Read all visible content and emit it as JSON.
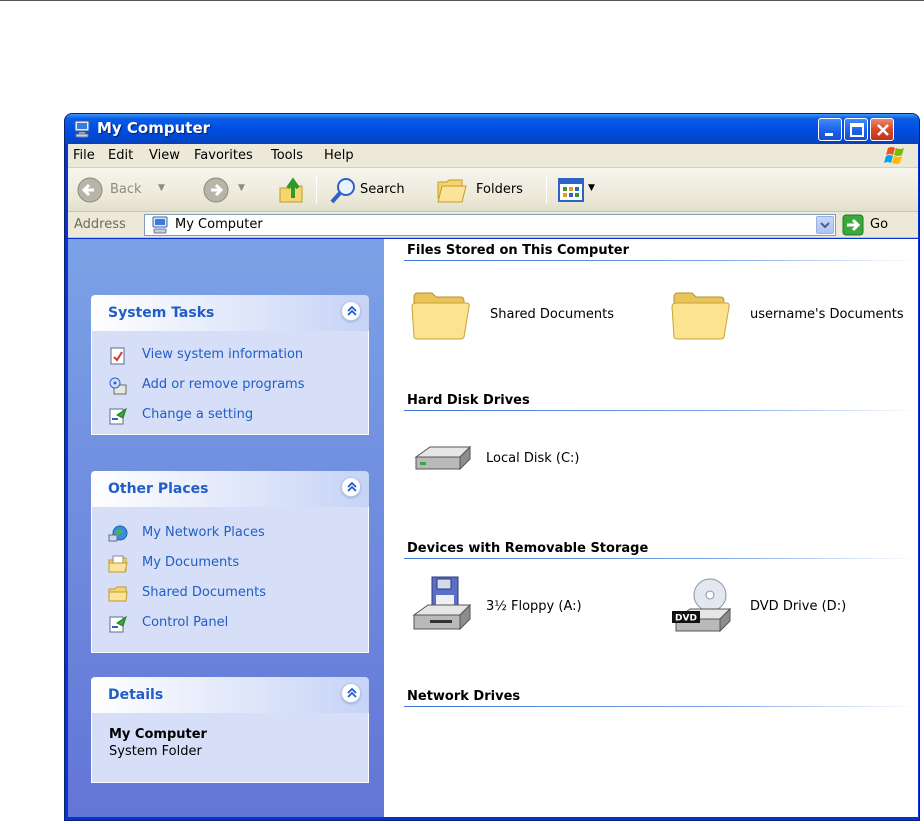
{
  "window": {
    "title": "My Computer"
  },
  "menu": {
    "file": "File",
    "edit": "Edit",
    "view": "View",
    "favorites": "Favorites",
    "tools": "Tools",
    "help": "Help"
  },
  "toolbar": {
    "back": "Back",
    "search": "Search",
    "folders": "Folders"
  },
  "address": {
    "label": "Address",
    "value": "My Computer",
    "go": "Go"
  },
  "panels": {
    "system_tasks": {
      "title": "System Tasks",
      "items": [
        {
          "label": "View system information",
          "icon": "system-info-icon"
        },
        {
          "label": "Add or remove programs",
          "icon": "add-remove-programs-icon"
        },
        {
          "label": "Change a setting",
          "icon": "control-panel-icon"
        }
      ]
    },
    "other_places": {
      "title": "Other Places",
      "items": [
        {
          "label": "My Network Places",
          "icon": "network-places-icon"
        },
        {
          "label": "My Documents",
          "icon": "my-documents-icon"
        },
        {
          "label": "Shared Documents",
          "icon": "folder-icon"
        },
        {
          "label": "Control Panel",
          "icon": "control-panel-icon"
        }
      ]
    },
    "details": {
      "title": "Details",
      "name": "My Computer",
      "type": "System Folder"
    }
  },
  "groups": {
    "files": {
      "title": "Files Stored on This Computer",
      "items": [
        {
          "label": "Shared Documents",
          "icon": "folder-icon"
        },
        {
          "label": "username's Documents",
          "icon": "folder-icon"
        }
      ]
    },
    "hdd": {
      "title": "Hard Disk Drives",
      "items": [
        {
          "label": "Local Disk (C:)",
          "icon": "hard-disk-icon"
        }
      ]
    },
    "removable": {
      "title": "Devices with Removable Storage",
      "items": [
        {
          "label": "3½ Floppy (A:)",
          "icon": "floppy-drive-icon"
        },
        {
          "label": "DVD Drive (D:)",
          "icon": "dvd-drive-icon"
        }
      ]
    },
    "network": {
      "title": "Network Drives"
    }
  },
  "colors": {
    "titlebar": "#0054e3",
    "taskpane_link": "#215dc6",
    "taskpane_bg": "#6f8ee0",
    "panel_body": "#d6dff7"
  }
}
